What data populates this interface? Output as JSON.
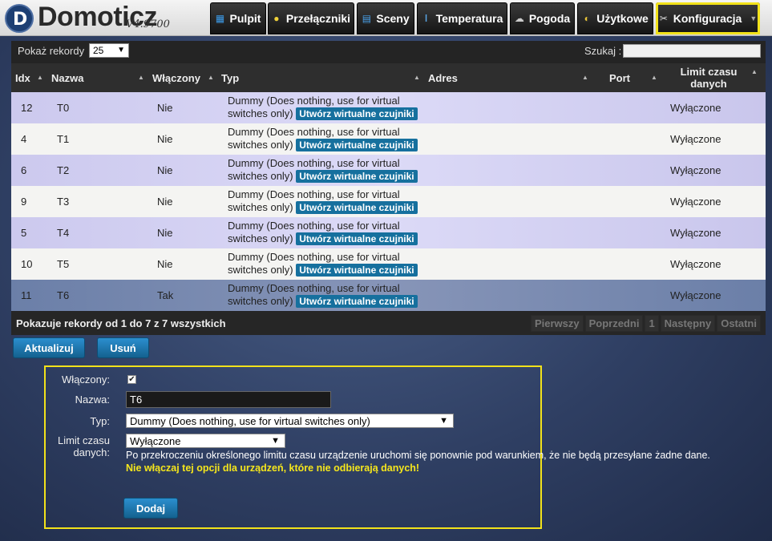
{
  "app": {
    "logo_letter": "D",
    "name": "Domoticz",
    "version": "V4.9700"
  },
  "nav": [
    {
      "label": "Pulpit",
      "icon": "dashboard-icon",
      "glyph": "▦"
    },
    {
      "label": "Przełączniki",
      "icon": "lightbulb-icon",
      "glyph": "💡"
    },
    {
      "label": "Sceny",
      "icon": "clapperboard-icon",
      "glyph": "▤"
    },
    {
      "label": "Temperatura",
      "icon": "thermometer-icon",
      "glyph": "🌡"
    },
    {
      "label": "Pogoda",
      "icon": "cloud-icon",
      "glyph": "☁"
    },
    {
      "label": "Użytkowe",
      "icon": "utility-icon",
      "glyph": "◐"
    },
    {
      "label": "Konfiguracja",
      "icon": "wrench-icon",
      "glyph": "✂",
      "active": true
    }
  ],
  "table": {
    "show_label": "Pokaż rekordy",
    "page_size": "25",
    "search_label": "Szukaj :",
    "search_value": "",
    "columns": [
      "Idx",
      "Nazwa",
      "Włączony",
      "Typ",
      "Adres",
      "Port",
      "Limit czasu danych"
    ],
    "type_text": "Dummy (Does nothing, use for virtual switches only)",
    "type_line1": "Dummy (Does nothing, use for virtual",
    "type_line2": "switches only)",
    "virtual_button": "Utwórz wirtualne czujniki",
    "rows": [
      {
        "idx": "12",
        "name": "T0",
        "enabled": "Nie",
        "timeout": "Wyłączone"
      },
      {
        "idx": "4",
        "name": "T1",
        "enabled": "Nie",
        "timeout": "Wyłączone"
      },
      {
        "idx": "6",
        "name": "T2",
        "enabled": "Nie",
        "timeout": "Wyłączone"
      },
      {
        "idx": "9",
        "name": "T3",
        "enabled": "Nie",
        "timeout": "Wyłączone"
      },
      {
        "idx": "5",
        "name": "T4",
        "enabled": "Nie",
        "timeout": "Wyłączone"
      },
      {
        "idx": "10",
        "name": "T5",
        "enabled": "Nie",
        "timeout": "Wyłączone"
      },
      {
        "idx": "11",
        "name": "T6",
        "enabled": "Tak",
        "timeout": "Wyłączone",
        "selected": true
      }
    ],
    "info": "Pokazuje rekordy od 1 do 7 z 7 wszystkich",
    "pager": [
      "Pierwszy",
      "Poprzedni",
      "1",
      "Następny",
      "Ostatni"
    ]
  },
  "actions": {
    "update": "Aktualizuj",
    "delete": "Usuń"
  },
  "form": {
    "enabled_label": "Włączony:",
    "enabled_checked": true,
    "name_label": "Nazwa:",
    "name_value": "T6",
    "type_label": "Typ:",
    "type_value": "Dummy (Does nothing, use for virtual switches only)",
    "timeout_label_1": "Limit czasu",
    "timeout_label_2": "danych:",
    "timeout_value": "Wyłączone",
    "help": "Po przekroczeniu określonego limitu czasu urządzenie uruchomi się ponownie pod warunkiem, że nie będą przesyłane żadne dane.",
    "warning": "Nie włączaj tej opcji dla urządzeń, które nie odbierają danych!",
    "add": "Dodaj"
  },
  "colors": {
    "accent": "#f2e21a",
    "button": "#1d7bb5",
    "warning_text": "#f5e61c"
  }
}
